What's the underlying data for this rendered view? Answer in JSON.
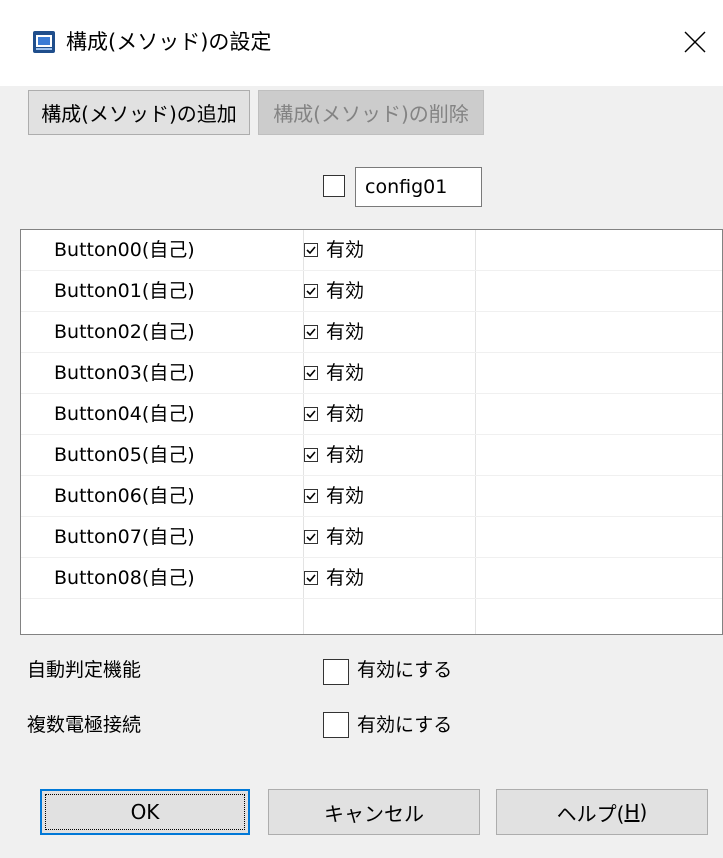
{
  "window": {
    "title": "構成(メソッド)の設定"
  },
  "toolbar": {
    "add_label": "構成(メソッド)の追加",
    "delete_label": "構成(メソッド)の削除"
  },
  "config": {
    "checked": false,
    "name": "config01"
  },
  "table": {
    "rows": [
      {
        "name": "Button00(自己)",
        "checked": true,
        "status": "有効"
      },
      {
        "name": "Button01(自己)",
        "checked": true,
        "status": "有効"
      },
      {
        "name": "Button02(自己)",
        "checked": true,
        "status": "有効"
      },
      {
        "name": "Button03(自己)",
        "checked": true,
        "status": "有効"
      },
      {
        "name": "Button04(自己)",
        "checked": true,
        "status": "有効"
      },
      {
        "name": "Button05(自己)",
        "checked": true,
        "status": "有効"
      },
      {
        "name": "Button06(自己)",
        "checked": true,
        "status": "有効"
      },
      {
        "name": "Button07(自己)",
        "checked": true,
        "status": "有効"
      },
      {
        "name": "Button08(自己)",
        "checked": true,
        "status": "有効"
      }
    ]
  },
  "options": {
    "auto_judge_label": "自動判定機能",
    "auto_judge_check_label": "有効にする",
    "auto_judge_checked": false,
    "multi_electrode_label": "複数電極接続",
    "multi_electrode_check_label": "有効にする",
    "multi_electrode_checked": false
  },
  "footer": {
    "ok_label": "OK",
    "cancel_label": "キャンセル",
    "help_label": "ヘルプ(",
    "help_mnemonic": "H",
    "help_suffix": ")"
  },
  "icons": {
    "app": "app-config-icon",
    "close": "close-icon",
    "check": "checkmark-icon"
  },
  "colors": {
    "dialog_bg": "#f0f0f0",
    "default_button_border": "#0078d7",
    "disabled_text": "#838383"
  }
}
